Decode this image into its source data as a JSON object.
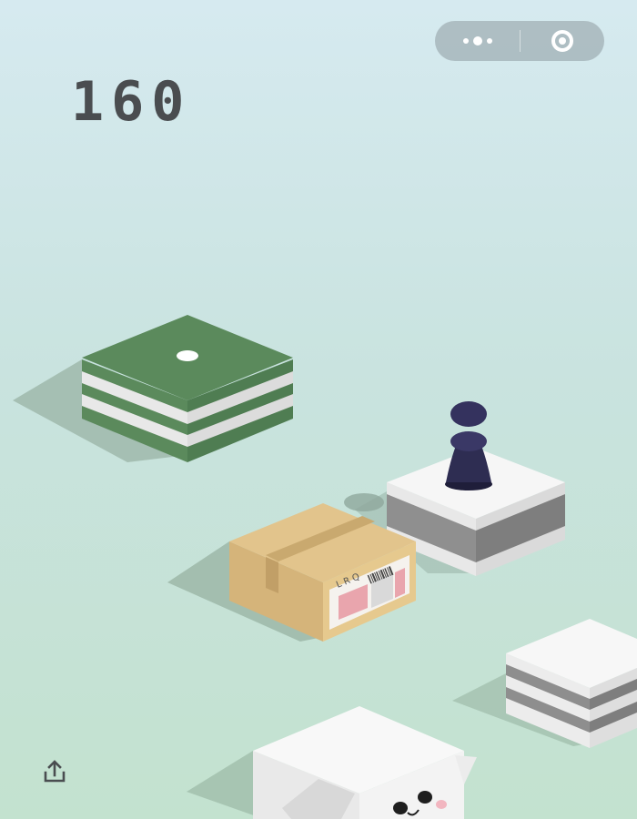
{
  "game": {
    "score": "160",
    "box_label": "L R Q"
  },
  "menu_capsule": {
    "more_icon": "more-dots-icon",
    "close_icon": "target-ring-icon"
  },
  "share_icon": "share-upload-icon",
  "colors": {
    "background_top": "#d6eaf0",
    "background_bottom": "#c3e2cf",
    "score_text": "#4a4d50",
    "green_block": "#5b8a5c",
    "cardboard": "#e2c48c",
    "player": "#2e2d52",
    "white_block": "#f4f4f4"
  }
}
